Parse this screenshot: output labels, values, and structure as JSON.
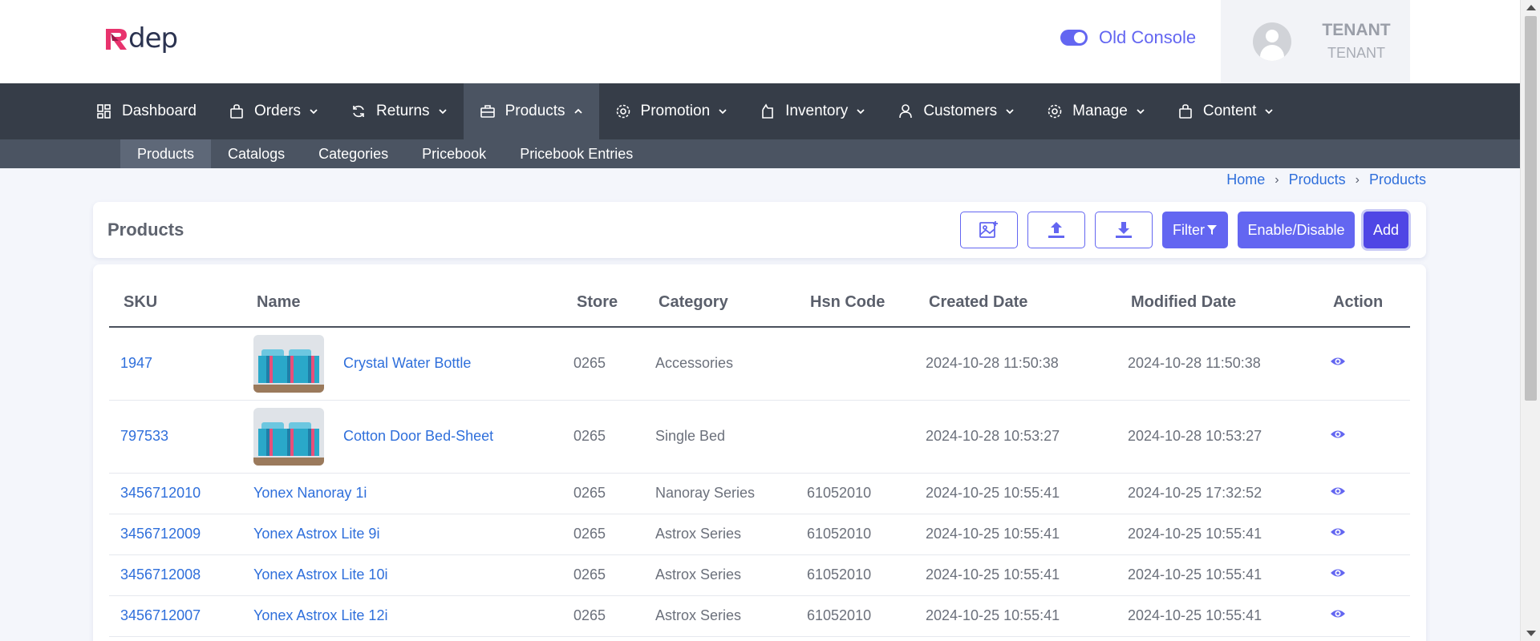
{
  "brand": {
    "logo_text": "dep",
    "logo_letter": "R"
  },
  "header": {
    "old_console_label": "Old Console",
    "user_name": "TENANT",
    "user_role": "TENANT"
  },
  "nav": {
    "items": [
      {
        "label": "Dashboard",
        "icon": "dashboard-icon"
      },
      {
        "label": "Orders",
        "icon": "bag-icon"
      },
      {
        "label": "Returns",
        "icon": "refresh-icon"
      },
      {
        "label": "Products",
        "icon": "briefcase-icon"
      },
      {
        "label": "Promotion",
        "icon": "gear-icon"
      },
      {
        "label": "Inventory",
        "icon": "box-icon"
      },
      {
        "label": "Customers",
        "icon": "user-icon"
      },
      {
        "label": "Manage",
        "icon": "gear-icon"
      },
      {
        "label": "Content",
        "icon": "bag-icon"
      }
    ],
    "active": "Products"
  },
  "subnav": {
    "items": [
      "Products",
      "Catalogs",
      "Categories",
      "Pricebook",
      "Pricebook Entries"
    ],
    "active": "Products"
  },
  "breadcrumb": [
    "Home",
    "Products",
    "Products"
  ],
  "page": {
    "title": "Products",
    "filter_label": "Filter",
    "enable_disable_label": "Enable/Disable",
    "add_label": "Add"
  },
  "table": {
    "columns": [
      "SKU",
      "Name",
      "Store",
      "Category",
      "Hsn Code",
      "Created Date",
      "Modified Date",
      "Action"
    ],
    "rows": [
      {
        "sku": "1947",
        "name": "Crystal Water Bottle",
        "store": "0265",
        "category": "Accessories",
        "hsn": "",
        "created": "2024-10-28 11:50:38",
        "modified": "2024-10-28 11:50:38"
      },
      {
        "sku": "797533",
        "name": "Cotton Door Bed-Sheet",
        "store": "0265",
        "category": "Single Bed",
        "hsn": "",
        "created": "2024-10-28 10:53:27",
        "modified": "2024-10-28 10:53:27"
      },
      {
        "sku": "3456712010",
        "name": "Yonex Nanoray 1i",
        "store": "0265",
        "category": "Nanoray Series",
        "hsn": "61052010",
        "created": "2024-10-25 10:55:41",
        "modified": "2024-10-25 17:32:52"
      },
      {
        "sku": "3456712009",
        "name": "Yonex Astrox Lite 9i",
        "store": "0265",
        "category": "Astrox Series",
        "hsn": "61052010",
        "created": "2024-10-25 10:55:41",
        "modified": "2024-10-25 10:55:41"
      },
      {
        "sku": "3456712008",
        "name": "Yonex Astrox Lite 10i",
        "store": "0265",
        "category": "Astrox Series",
        "hsn": "61052010",
        "created": "2024-10-25 10:55:41",
        "modified": "2024-10-25 10:55:41"
      },
      {
        "sku": "3456712007",
        "name": "Yonex Astrox Lite 12i",
        "store": "0265",
        "category": "Astrox Series",
        "hsn": "61052010",
        "created": "2024-10-25 10:55:41",
        "modified": "2024-10-25 10:55:41"
      }
    ]
  },
  "colors": {
    "accent": "#6366f1",
    "link": "#2f6fdb",
    "nav_bg": "#363d48",
    "subnav_bg": "#4b5462"
  }
}
